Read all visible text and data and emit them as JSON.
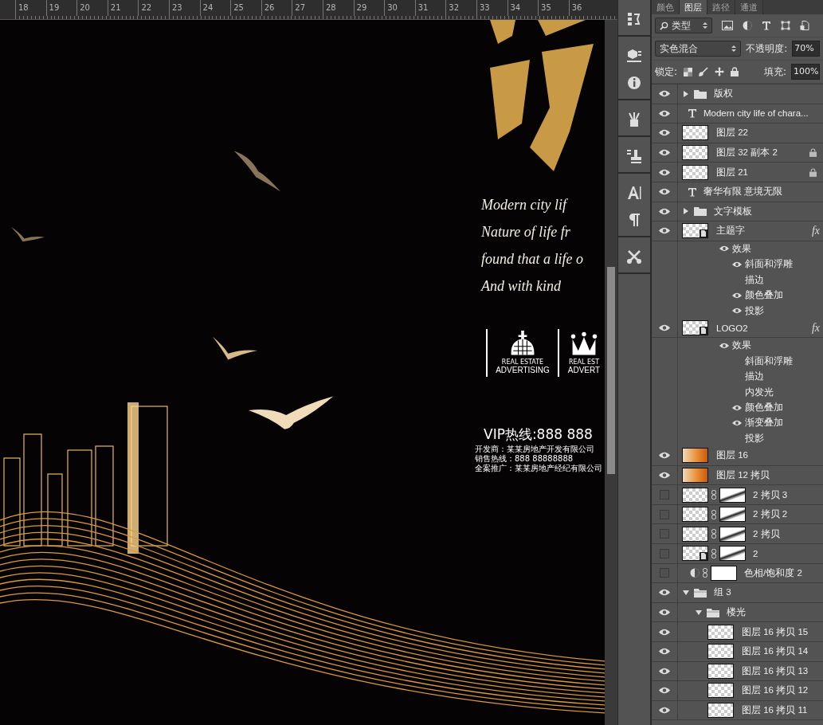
{
  "ruler": {
    "ticks": [
      "18",
      "19",
      "20",
      "21",
      "22",
      "23",
      "24",
      "25",
      "26",
      "27",
      "28",
      "29",
      "30",
      "31",
      "32",
      "33",
      "34",
      "35",
      "36"
    ]
  },
  "poster": {
    "script_lines": [
      "Modern city lif",
      "Nature of life fr",
      "found that a life o",
      "And with kind"
    ],
    "logos": [
      {
        "top": "REAL ESTATE",
        "bottom": "ADVERTISING",
        "kind": "dome"
      },
      {
        "top": "REAL EST",
        "bottom": "ADVERT",
        "kind": "crown"
      }
    ],
    "hotline": "VIP热线:888 888",
    "info_lines": [
      "开发商：某某房地产开发有限公司",
      "销售热线：888 88888888",
      "全案推广：某某房地产经纪有限公司"
    ]
  },
  "tabs": [
    {
      "label": "颜色",
      "selected": false
    },
    {
      "label": "图层",
      "selected": true
    },
    {
      "label": "路径",
      "selected": false
    },
    {
      "label": "通道",
      "selected": false
    }
  ],
  "filter": {
    "value": "类型"
  },
  "blend": {
    "mode": "实色混合",
    "opacity_label": "不透明度:",
    "opacity": "70%"
  },
  "lock": {
    "label": "锁定:",
    "fill_label": "填充:",
    "fill": "100%"
  },
  "layers": [
    {
      "kind": "group",
      "name": "版权",
      "visible": true,
      "locked": false,
      "expanded": false
    },
    {
      "kind": "text",
      "name": "Modern city life of chara...",
      "visible": true,
      "locked": false
    },
    {
      "kind": "pixel",
      "name": "图层 22",
      "visible": true,
      "locked": false
    },
    {
      "kind": "pixel",
      "name": "图层 32 副本 2",
      "visible": true,
      "locked": true
    },
    {
      "kind": "pixel",
      "name": "图层 21",
      "visible": true,
      "locked": true
    },
    {
      "kind": "text",
      "name": "奢华有限 意境无限",
      "visible": true,
      "locked": false
    },
    {
      "kind": "group",
      "name": "文字模板",
      "visible": true,
      "locked": false,
      "expanded": false
    },
    {
      "kind": "smart",
      "name": "主题字",
      "visible": true,
      "locked": false,
      "effects": {
        "badge": "fx",
        "label": "效果",
        "visible": true,
        "items": [
          {
            "name": "斜面和浮雕",
            "visible": true
          },
          {
            "name": "描边",
            "visible": false
          },
          {
            "name": "颜色叠加",
            "visible": true
          },
          {
            "name": "投影",
            "visible": true
          }
        ]
      }
    },
    {
      "kind": "smart",
      "name": "LOGO2",
      "visible": true,
      "locked": false,
      "effects": {
        "badge": "fx",
        "label": "效果",
        "visible": true,
        "items": [
          {
            "name": "斜面和浮雕",
            "visible": false
          },
          {
            "name": "描边",
            "visible": false
          },
          {
            "name": "内发光",
            "visible": false
          },
          {
            "name": "颜色叠加",
            "visible": true
          },
          {
            "name": "渐变叠加",
            "visible": true
          },
          {
            "name": "投影",
            "visible": false
          }
        ]
      }
    },
    {
      "kind": "image",
      "name": "图层 16",
      "visible": true,
      "locked": false
    },
    {
      "kind": "image",
      "name": "图层 12 拷贝",
      "visible": true,
      "locked": false
    },
    {
      "kind": "masked",
      "name": "2 拷贝 3",
      "visible": false,
      "locked": false
    },
    {
      "kind": "masked",
      "name": "2 拷贝 2",
      "visible": false,
      "locked": false
    },
    {
      "kind": "masked",
      "name": "2 拷贝",
      "visible": false,
      "locked": false
    },
    {
      "kind": "smart-masked",
      "name": "2",
      "visible": false,
      "locked": false
    },
    {
      "kind": "adjustment",
      "name": "色相/饱和度 2",
      "visible": false,
      "locked": false
    },
    {
      "kind": "group",
      "name": "组 3",
      "visible": true,
      "locked": false,
      "expanded": true,
      "children": [
        {
          "kind": "group",
          "name": "楼光",
          "visible": true,
          "locked": false,
          "expanded": true,
          "children": [
            {
              "kind": "pixel",
              "name": "图层 16 拷贝 15",
              "visible": true,
              "locked": false
            },
            {
              "kind": "pixel",
              "name": "图层 16 拷贝 14",
              "visible": true,
              "locked": false
            },
            {
              "kind": "pixel",
              "name": "图层 16 拷贝 13",
              "visible": true,
              "locked": false
            },
            {
              "kind": "pixel",
              "name": "图层 16 拷贝 12",
              "visible": true,
              "locked": false
            },
            {
              "kind": "pixel",
              "name": "图层 16 拷贝 11",
              "visible": true,
              "locked": false
            }
          ]
        }
      ]
    }
  ]
}
